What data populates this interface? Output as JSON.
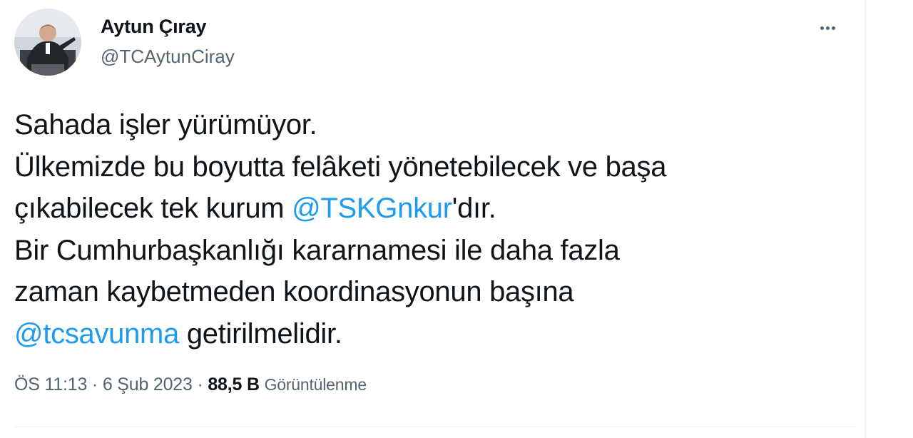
{
  "author": {
    "name": "Aytun Çıray",
    "handle": "@TCAytunCiray"
  },
  "tweet": {
    "lines": [
      [
        {
          "text": "Sahada işler yürümüyor."
        }
      ],
      [
        {
          "text": "Ülkemizde bu boyutta felâketi yönetebilecek ve başa"
        }
      ],
      [
        {
          "text": "çıkabilecek tek kurum "
        },
        {
          "text": "@TSKGnkur",
          "mention": true
        },
        {
          "text": "'dır."
        }
      ],
      [
        {
          "text": "Bir Cumhurbaşkanlığı kararnamesi ile daha fazla"
        }
      ],
      [
        {
          "text": "zaman kaybetmeden koordinasyonun başına"
        }
      ],
      [
        {
          "text": "@tcsavunma",
          "mention": true
        },
        {
          "text": " getirilmelidir."
        }
      ]
    ]
  },
  "meta": {
    "time": "ÖS 11:13",
    "separator": " · ",
    "date": "6 Şub 2023",
    "views_count": "88,5 B",
    "views_label": "Görüntülenme"
  },
  "icons": {
    "more": "more-horizontal-icon",
    "avatar": "profile-avatar"
  },
  "colors": {
    "text": "#0f1419",
    "secondary": "#536471",
    "link": "#1d9bf0",
    "divider": "#eff3f4"
  }
}
